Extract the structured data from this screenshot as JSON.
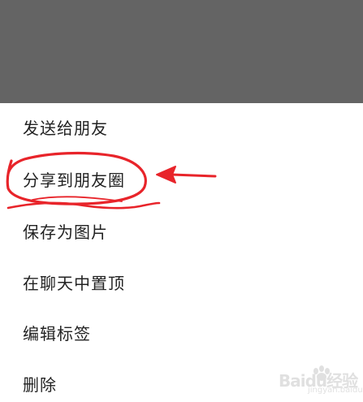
{
  "menu": {
    "items": [
      {
        "label": "发送给朋友"
      },
      {
        "label": "分享到朋友圈"
      },
      {
        "label": "保存为图片"
      },
      {
        "label": "在聊天中置顶"
      },
      {
        "label": "编辑标签"
      },
      {
        "label": "删除"
      }
    ]
  },
  "annotation": {
    "color": "#e8242a",
    "highlighted_item": "分享到朋友圈"
  },
  "watermark": {
    "brand": "Baidu经验",
    "sub": "jingyan.baidu.com"
  },
  "colors": {
    "overlay": "#646464",
    "sheet_bg": "#ffffff",
    "text": "#222222"
  }
}
